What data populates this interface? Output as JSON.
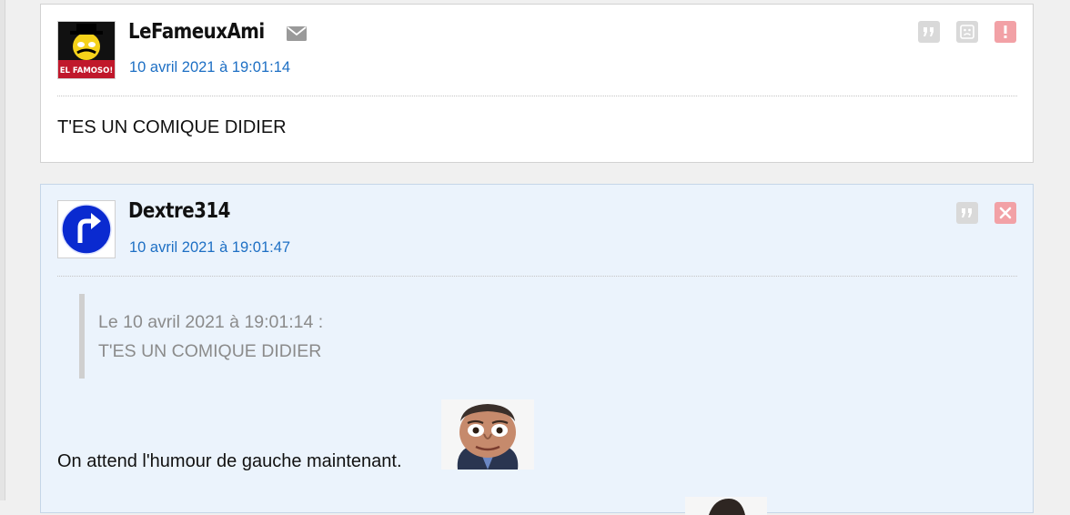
{
  "posts": [
    {
      "username": "LeFameuxAmi",
      "avatar_text": "EL FAMOSO!",
      "date": "10 avril 2021 à 19:01:14",
      "body": "T'ES UN COMIQUE DIDIER",
      "actions": [
        "quote-icon",
        "sad-face-icon",
        "report-icon"
      ]
    },
    {
      "username": "Dextre314",
      "date": "10 avril 2021 à 19:01:47",
      "quote": {
        "header": "Le 10 avril 2021 à 19:01:14 :",
        "text": "T'ES UN COMIQUE DIDIER"
      },
      "body": "On attend l'humour de gauche maintenant.",
      "actions": [
        "quote-icon",
        "delete-icon"
      ]
    }
  ],
  "colors": {
    "date_link": "#1d6fc4",
    "own_post_bg": "#ebf3fc",
    "action_grey": "#d9d9d9",
    "action_red": "#f2a1a6"
  }
}
